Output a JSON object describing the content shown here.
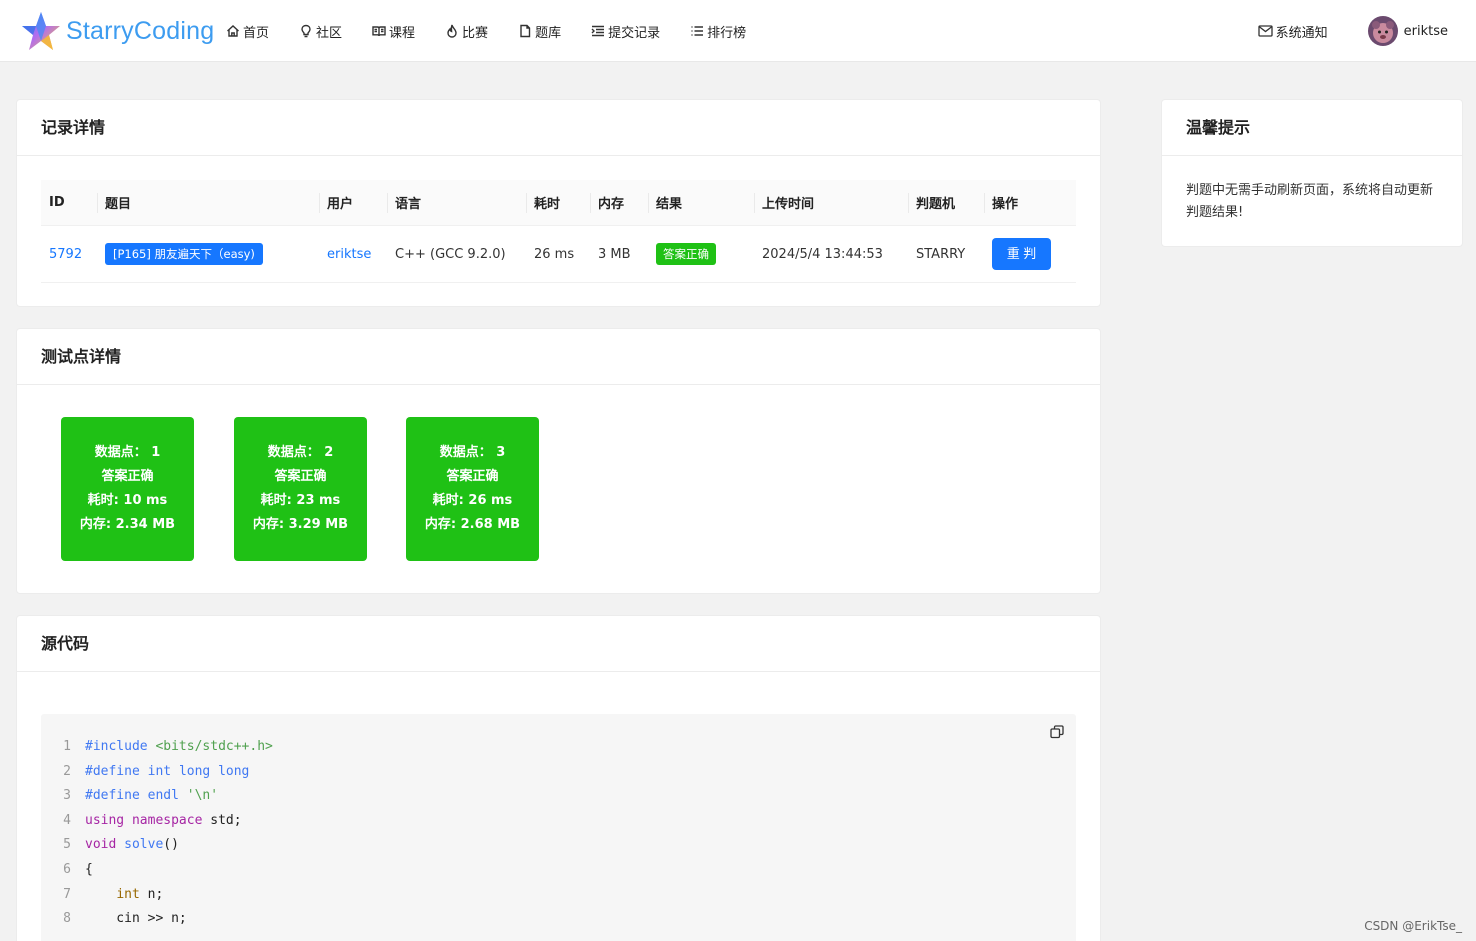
{
  "brand": {
    "name": "StarryCoding"
  },
  "nav": [
    {
      "label": "首页",
      "icon": "home-icon"
    },
    {
      "label": "社区",
      "icon": "bulb-icon"
    },
    {
      "label": "课程",
      "icon": "book-icon"
    },
    {
      "label": "比赛",
      "icon": "fire-icon"
    },
    {
      "label": "题库",
      "icon": "file-icon"
    },
    {
      "label": "提交记录",
      "icon": "list-indent-icon"
    },
    {
      "label": "排行榜",
      "icon": "list-icon"
    }
  ],
  "header": {
    "notification_label": "系统通知",
    "username": "eriktse"
  },
  "record": {
    "title": "记录详情",
    "columns": [
      "ID",
      "题目",
      "用户",
      "语言",
      "耗时",
      "内存",
      "结果",
      "上传时间",
      "判题机",
      "操作"
    ],
    "row": {
      "id": "5792",
      "problem": "[P165] 朋友遍天下（easy)",
      "user": "eriktse",
      "language": "C++ (GCC 9.2.0)",
      "time": "26 ms",
      "memory": "3 MB",
      "result": "答案正确",
      "upload_time": "2024/5/4 13:44:53",
      "judger": "STARRY",
      "action": "重 判"
    }
  },
  "testpoints": {
    "title": "测试点详情",
    "items": [
      {
        "label": "数据点： 1",
        "status": "答案正确",
        "time": "耗时: 10 ms",
        "memory": "内存: 2.34 MB"
      },
      {
        "label": "数据点： 2",
        "status": "答案正确",
        "time": "耗时: 23 ms",
        "memory": "内存: 3.29 MB"
      },
      {
        "label": "数据点： 3",
        "status": "答案正确",
        "time": "耗时: 26 ms",
        "memory": "内存: 2.68 MB"
      }
    ]
  },
  "source": {
    "title": "源代码",
    "line_numbers": [
      "1",
      "2",
      "3",
      "4",
      "5",
      "6",
      "7",
      "8"
    ],
    "lines": [
      "#include <bits/stdc++.h>",
      "#define int long long",
      "#define endl '\\n'",
      "using namespace std;",
      "void solve()",
      "{",
      "    int n;",
      "    cin >> n;"
    ]
  },
  "tips": {
    "title": "温馨提示",
    "text": "判题中无需手动刷新页面，系统将自动更新判题结果!"
  },
  "watermark": "CSDN @ErikTse_",
  "colors": {
    "accent": "#1677ff",
    "success": "#1fc115",
    "brand": "#3d9cf0"
  }
}
